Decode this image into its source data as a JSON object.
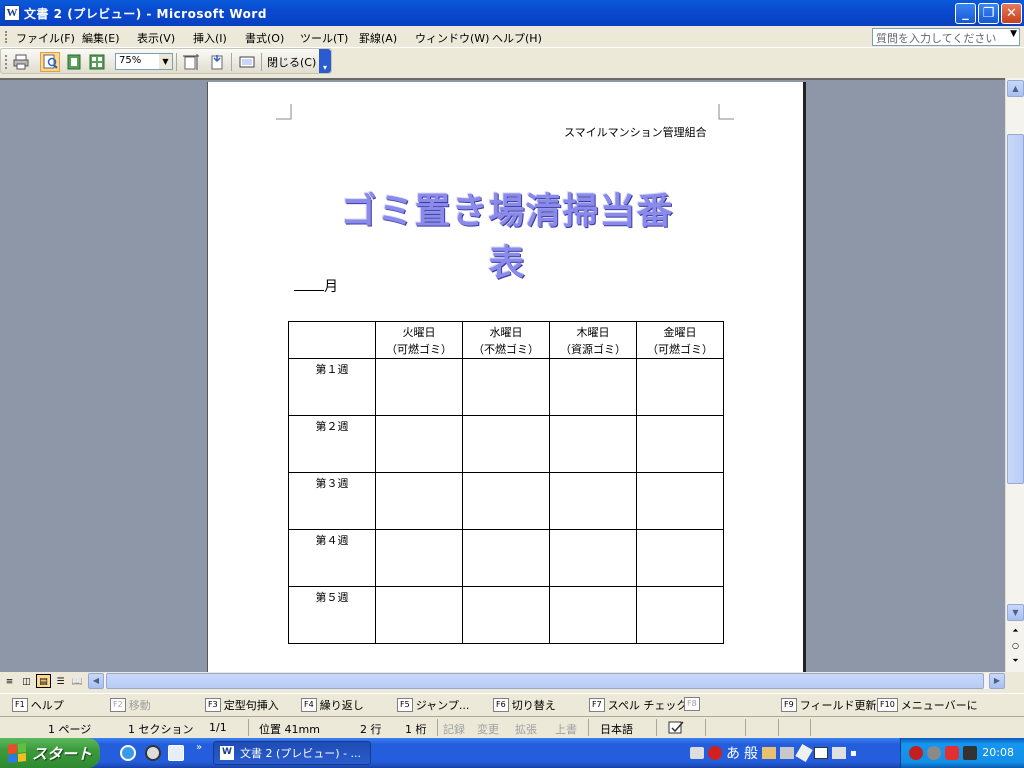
{
  "window": {
    "title": "文書 2 (プレビュー) - Microsoft Word",
    "icon": "word-icon",
    "controls": [
      "minimize-icon",
      "restore-icon",
      "close-icon"
    ]
  },
  "menubar": {
    "items": [
      "ファイル(F)",
      "編集(E)",
      "表示(V)",
      "挿入(I)",
      "書式(O)",
      "ツール(T)",
      "罫線(A)",
      "ウィンドウ(W)",
      "ヘルプ(H)"
    ],
    "help_placeholder": "質問を入力してください"
  },
  "toolbar": {
    "zoom": "75%",
    "close_label": "閉じる(C)",
    "icons": [
      "print-icon",
      "magnifier-icon",
      "one-page-icon",
      "multiple-pages-icon",
      "view-ruler-icon",
      "shrink-to-fit-icon",
      "full-screen-icon"
    ]
  },
  "document": {
    "organization": "スマイルマンション管理組合",
    "title": "ゴミ置き場清掃当番表",
    "month_label": "月",
    "table": {
      "header": [
        {
          "day": "",
          "type": ""
        },
        {
          "day": "火曜日",
          "type": "（可燃ゴミ）"
        },
        {
          "day": "水曜日",
          "type": "（不燃ゴミ）"
        },
        {
          "day": "木曜日",
          "type": "（資源ゴミ）"
        },
        {
          "day": "金曜日",
          "type": "（可燃ゴミ）"
        }
      ],
      "weeks": [
        "第１週",
        "第２週",
        "第３週",
        "第４週",
        "第５週"
      ]
    }
  },
  "fkeys": [
    {
      "key": "F1",
      "label": "ヘルプ",
      "enabled": true
    },
    {
      "key": "F2",
      "label": "移動",
      "enabled": false
    },
    {
      "key": "F3",
      "label": "定型句挿入",
      "enabled": true
    },
    {
      "key": "F4",
      "label": "繰り返し",
      "enabled": true
    },
    {
      "key": "F5",
      "label": "ジャンプ...",
      "enabled": true
    },
    {
      "key": "F6",
      "label": "切り替え",
      "enabled": true
    },
    {
      "key": "F7",
      "label": "スペル チェック...",
      "enabled": true
    },
    {
      "key": "F8",
      "label": "",
      "enabled": false
    },
    {
      "key": "F9",
      "label": "フィールド更新",
      "enabled": true
    },
    {
      "key": "F10",
      "label": "メニューバーに",
      "enabled": true
    }
  ],
  "statusbar": {
    "page": "1 ページ",
    "section": "1 セクション",
    "page_of": "1/1",
    "position": "位置 41mm",
    "line": "2 行",
    "column": "1 桁",
    "rec": "記録",
    "trk": "変更",
    "ext": "拡張",
    "ovr": "上書",
    "language": "日本語"
  },
  "taskbar": {
    "start_label": "スタート",
    "task_label": "文書 2 (プレビュー) - ...",
    "ime_mode": "あ",
    "ime_dict": "般",
    "clock": "20:08"
  },
  "colors": {
    "title_text": "#8a8aea",
    "titlebar": "#0a4ad0",
    "taskbar": "#245edc",
    "start": "#3c9a3c"
  }
}
